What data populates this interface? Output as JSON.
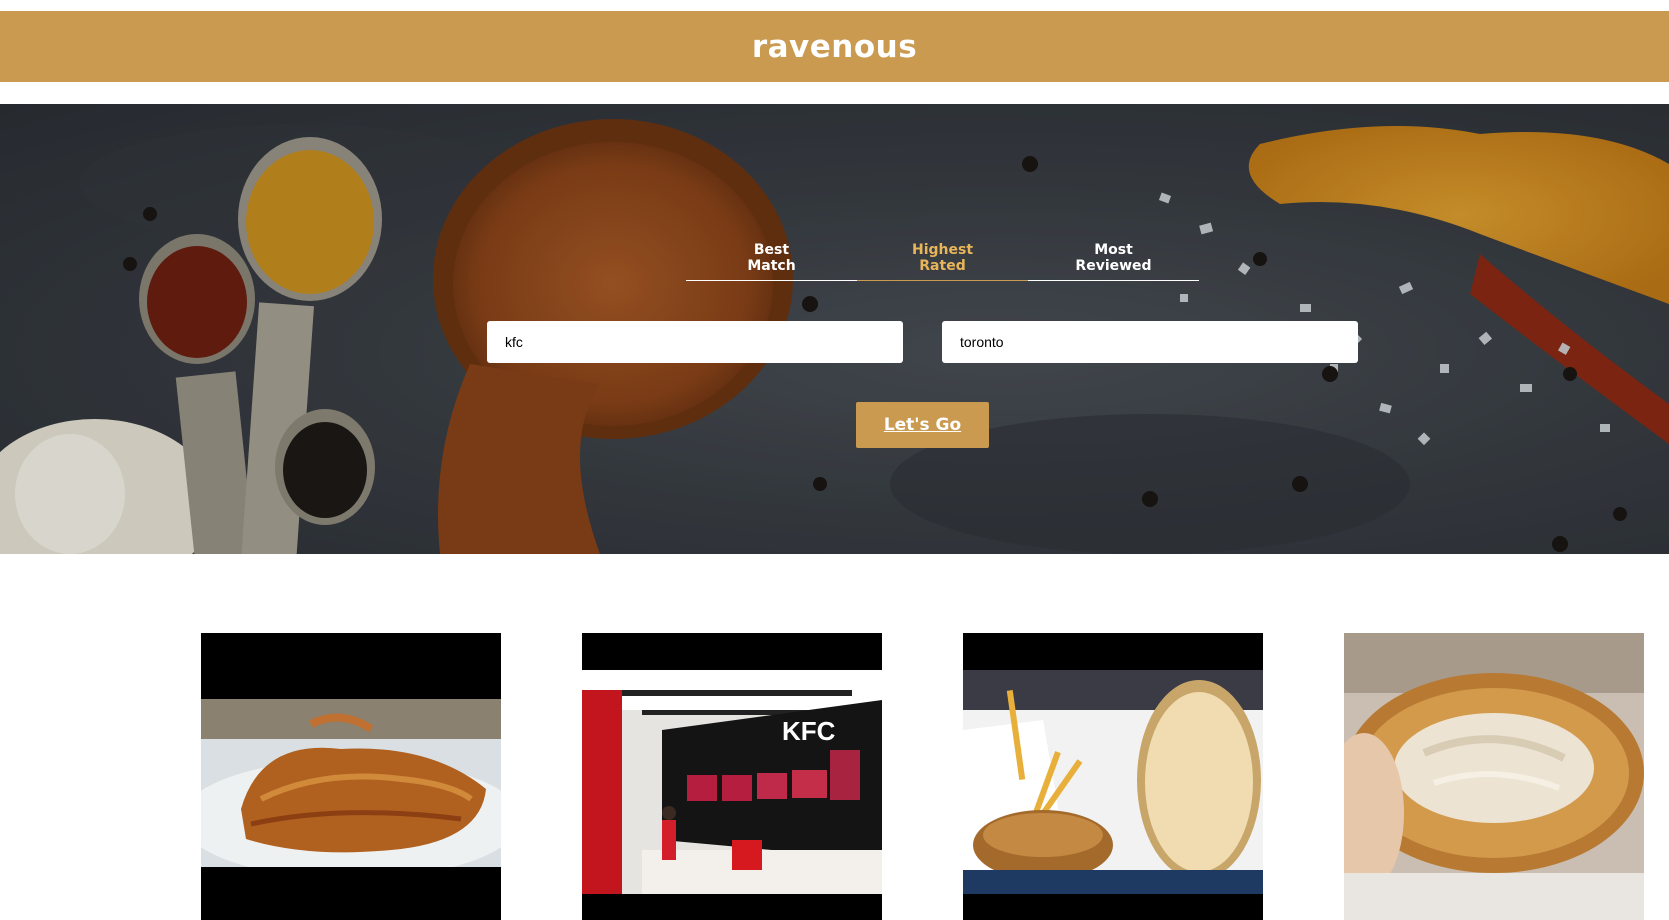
{
  "header": {
    "brand": "ravenous"
  },
  "sort_tabs": [
    {
      "label_line1": "Best",
      "label_line2": "Match",
      "active": false
    },
    {
      "label_line1": "Highest",
      "label_line2": "Rated",
      "active": true
    },
    {
      "label_line1": "Most",
      "label_line2": "Reviewed",
      "active": false
    }
  ],
  "search": {
    "term_value": "kfc",
    "location_value": "toronto",
    "submit_label": "Let's Go"
  },
  "colors": {
    "accent": "#c99a4f",
    "active_tab": "#e8b55a"
  },
  "business_cards": [
    {
      "image": "fried-chicken-fillet-photo"
    },
    {
      "image": "kfc-restaurant-interior-photo"
    },
    {
      "image": "chicken-sandwich-fries-photo"
    },
    {
      "image": "chicken-sandwich-closeup-photo"
    }
  ]
}
